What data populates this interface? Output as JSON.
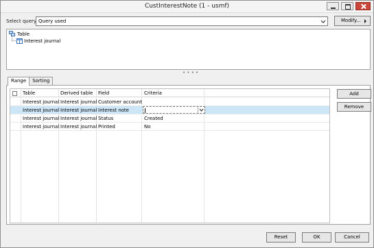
{
  "window": {
    "title": "CustInterestNote (1 - usmf)"
  },
  "select_query": {
    "label": "Select query:",
    "value": "Query used"
  },
  "modify_button": {
    "label": "Modify..."
  },
  "tree": {
    "root_label": "Table",
    "child_label": "Interest journal"
  },
  "tabs": [
    {
      "label": "Range",
      "active": true
    },
    {
      "label": "Sorting",
      "active": false
    }
  ],
  "grid": {
    "columns": [
      "Table",
      "Derived table",
      "Field",
      "Criteria"
    ],
    "rows": [
      {
        "table": "Interest journal",
        "derived": "Interest journal",
        "field": "Customer account",
        "criteria": ""
      },
      {
        "table": "Interest journal",
        "derived": "Interest journal",
        "field": "Interest note",
        "criteria": "",
        "selected": true
      },
      {
        "table": "Interest journal",
        "derived": "Interest journal",
        "field": "Status",
        "criteria": "Created"
      },
      {
        "table": "Interest journal",
        "derived": "Interest journal",
        "field": "Printed",
        "criteria": "No"
      }
    ]
  },
  "side_buttons": {
    "add": "Add",
    "remove": "Remove"
  },
  "bottom_buttons": {
    "reset": "Reset",
    "ok": "OK",
    "cancel": "Cancel"
  },
  "colors": {
    "selected_row": "#cde6f7",
    "close_button": "#c8463a"
  }
}
